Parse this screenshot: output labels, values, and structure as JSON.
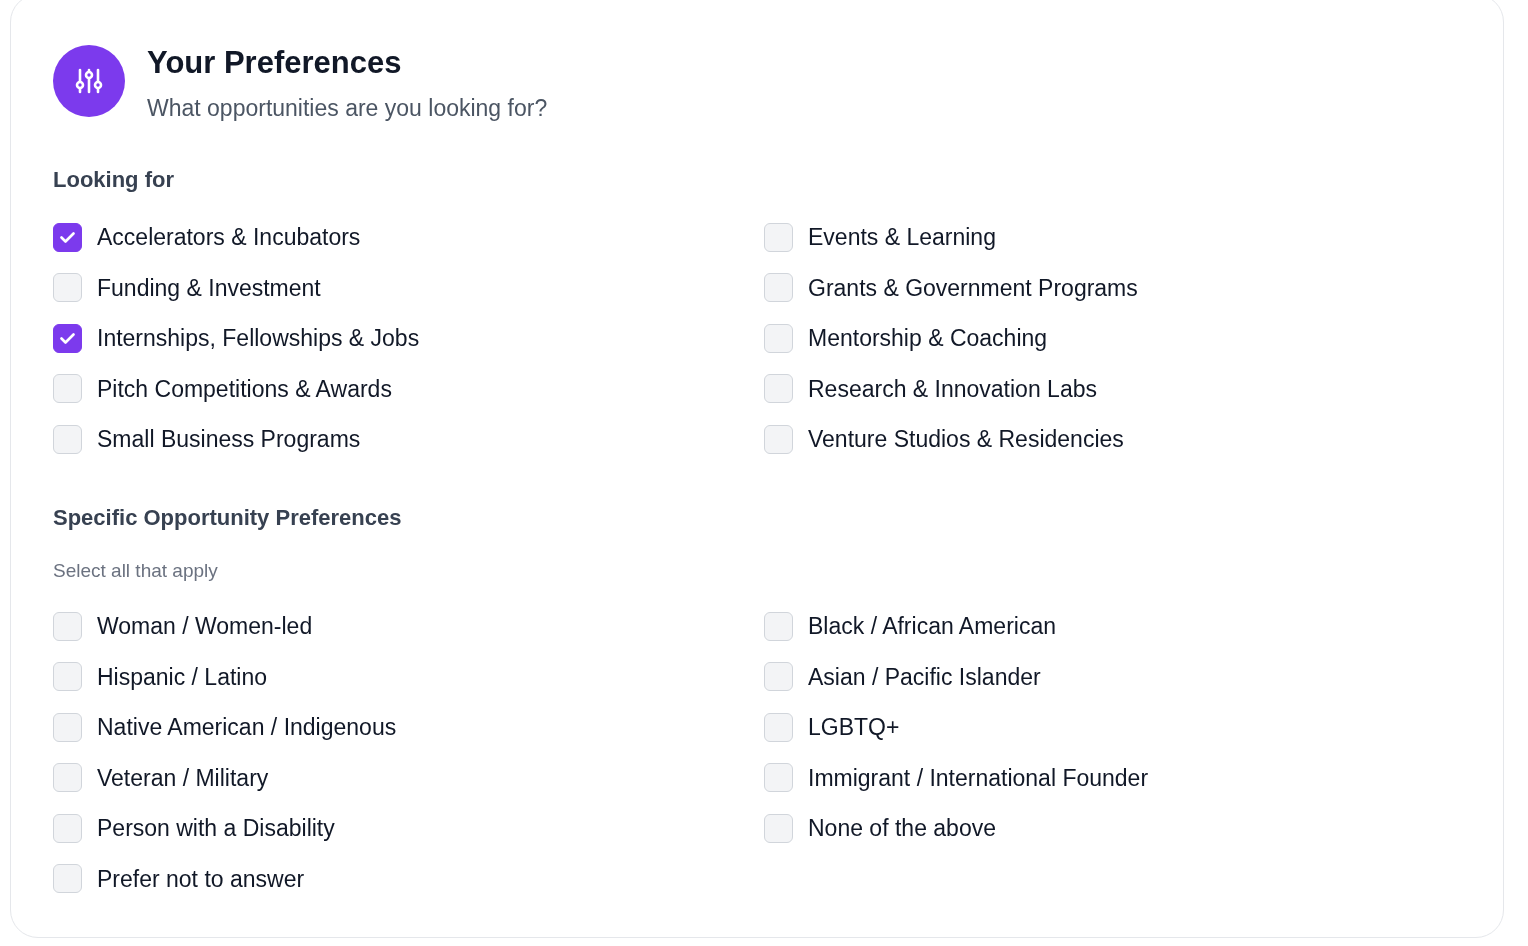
{
  "header": {
    "title": "Your Preferences",
    "subtitle": "What opportunities are you looking for?"
  },
  "sections": [
    {
      "title": "Looking for",
      "options": [
        {
          "label": "Accelerators & Incubators",
          "checked": true
        },
        {
          "label": "Events & Learning",
          "checked": false
        },
        {
          "label": "Funding & Investment",
          "checked": false
        },
        {
          "label": "Grants & Government Programs",
          "checked": false
        },
        {
          "label": "Internships, Fellowships & Jobs",
          "checked": true
        },
        {
          "label": "Mentorship & Coaching",
          "checked": false
        },
        {
          "label": "Pitch Competitions & Awards",
          "checked": false
        },
        {
          "label": "Research & Innovation Labs",
          "checked": false
        },
        {
          "label": "Small Business Programs",
          "checked": false
        },
        {
          "label": "Venture Studios & Residencies",
          "checked": false
        }
      ]
    },
    {
      "title": "Specific Opportunity Preferences",
      "hint": "Select all that apply",
      "options": [
        {
          "label": "Woman / Women-led",
          "checked": false
        },
        {
          "label": "Black / African American",
          "checked": false
        },
        {
          "label": "Hispanic / Latino",
          "checked": false
        },
        {
          "label": "Asian / Pacific Islander",
          "checked": false
        },
        {
          "label": "Native American / Indigenous",
          "checked": false
        },
        {
          "label": "LGBTQ+",
          "checked": false
        },
        {
          "label": "Veteran / Military",
          "checked": false
        },
        {
          "label": "Immigrant / International Founder",
          "checked": false
        },
        {
          "label": "Person with a Disability",
          "checked": false
        },
        {
          "label": "None of the above",
          "checked": false
        },
        {
          "label": "Prefer not to answer",
          "checked": false
        }
      ]
    }
  ]
}
